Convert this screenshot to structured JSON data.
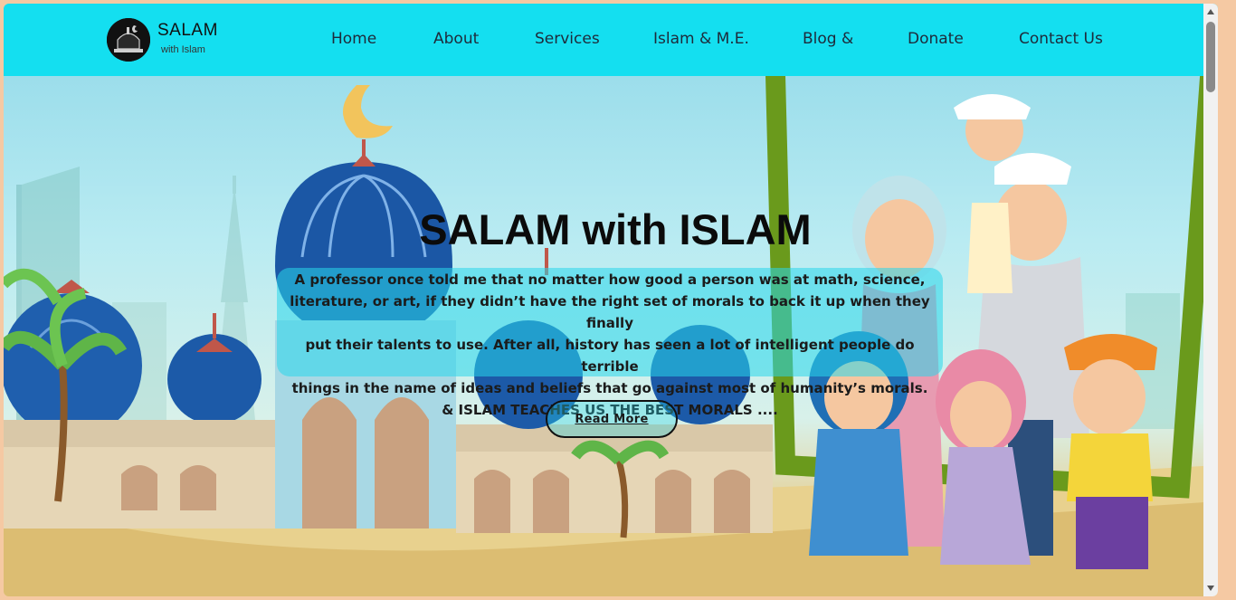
{
  "brand": {
    "name": "SALAM",
    "tagline": "with Islam"
  },
  "nav": {
    "items": [
      {
        "label": "Home"
      },
      {
        "label": "About"
      },
      {
        "label": "Services"
      },
      {
        "label": "Islam & M.E."
      },
      {
        "label": "Blog &"
      },
      {
        "label": "Donate"
      },
      {
        "label": "Contact Us"
      }
    ]
  },
  "hero": {
    "title": "SALAM with ISLAM",
    "lines": [
      "A professor once told me that no matter how good a person was at math, science,",
      "literature, or art, if they didn’t have the right set of morals to back it up when they finally",
      "put their talents to use. After all, history has seen a lot of intelligent people do terrible",
      "things in the name of ideas and beliefs that go against most of humanity’s morals.",
      "& ISLAM TEACHES US THE BEST MORALS ...."
    ],
    "button": "Read More"
  },
  "colors": {
    "navbar": "#14dff0",
    "page_border": "#f5c9a3",
    "text_dark": "#1b1b1b"
  },
  "icons": {
    "logo": "mosque-logo-icon"
  }
}
